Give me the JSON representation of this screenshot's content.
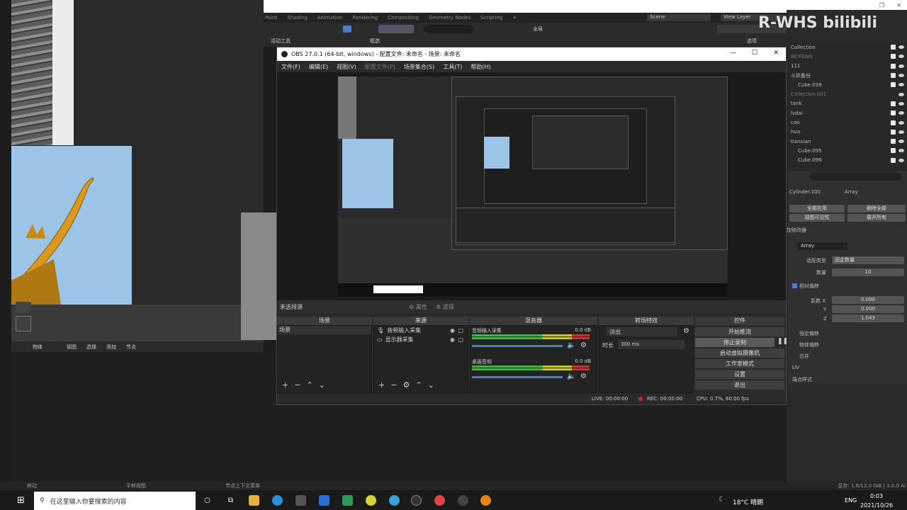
{
  "blender": {
    "tabs": [
      "Paint",
      "Shading",
      "Animation",
      "Rendering",
      "Compositing",
      "Geometry Nodes",
      "Scripting",
      "+"
    ],
    "scene_label": "Scene",
    "view_layer_label": "View Layer",
    "active_tool_label": "活动工具",
    "select_label": "框选",
    "global_label": "全局",
    "options_label": "选项",
    "outliner": [
      {
        "name": "Collection"
      },
      {
        "name": "BEIFENG"
      },
      {
        "name": "111"
      },
      {
        "name": "斗拱备份"
      },
      {
        "name": "Cube.038"
      },
      {
        "name": "Collection.001"
      },
      {
        "name": "tank"
      },
      {
        "name": "lvdai"
      },
      {
        "name": "cao"
      },
      {
        "name": "hua"
      },
      {
        "name": "tianxian"
      },
      {
        "name": "Cube.095"
      },
      {
        "name": "Cube.096"
      }
    ],
    "props": {
      "object_name": "Cylinder.100",
      "modifier_type_label": "Array",
      "apply_all": "全部应用",
      "delete_all": "删除全部",
      "viewport_vis": "视图可见性",
      "expand_all": "展开所有",
      "modifier_header": "加修改器",
      "modifier_name": "Array",
      "fit_type_label": "适配类型",
      "fit_type_value": "固定数量",
      "count_label": "数量",
      "count_value": "10",
      "relative_offset": "相对偏移",
      "factor_x_label": "系数 X",
      "factor_x": "0.000",
      "y_label": "Y",
      "factor_y": "0.000",
      "z_label": "Z",
      "factor_z": "1.043",
      "constant_offset": "恒定偏移",
      "object_offset": "物体偏移",
      "merge": "合并",
      "uv": "UV",
      "caps": "端点样式"
    },
    "node_bar": [
      "物体",
      "视图",
      "选择",
      "添加",
      "节点"
    ],
    "status": {
      "move": "移动",
      "pan": "平移视图",
      "context": "节点上下文菜单",
      "memory": "显存: 1.6/12.0 GiB | 3.0.0 Al"
    }
  },
  "obs": {
    "title": "OBS 27.0.1 (64-bit, windows) - 配置文件: 未命名 - 场景: 未命名",
    "menu": [
      "文件(F)",
      "编辑(E)",
      "视图(V)",
      "配置文件(P)",
      "场景集合(S)",
      "工具(T)",
      "帮助(H)"
    ],
    "no_source": "未选择源",
    "properties_btn": "属性",
    "filters_btn": "滤镜",
    "docks": {
      "scenes": "场景",
      "sources": "来源",
      "mixer": "混音器",
      "transitions": "转场特效",
      "controls": "控件"
    },
    "scene_item": "场景",
    "sources": [
      {
        "name": "音频输入采集"
      },
      {
        "name": "显示器采集"
      }
    ],
    "mixer": [
      {
        "name": "音频输入采集",
        "db": "0.0 dB"
      },
      {
        "name": "桌面音频",
        "db": "0.0 dB"
      }
    ],
    "transition_value": "淡出",
    "duration_label": "时长",
    "duration_value": "300 ms",
    "controls": [
      "开始推流",
      "停止录制",
      "启动虚拟摄像机",
      "工作室模式",
      "设置",
      "退出"
    ],
    "status": {
      "live": "LIVE: 00:00:00",
      "rec": "REC: 00:00:00",
      "cpu": "CPU: 0.7%, 60.00 fps"
    }
  },
  "taskbar": {
    "search_placeholder": "在这里输入你要搜索的内容",
    "weather": "18°C 晴朗",
    "lang": "ENG",
    "time": "0:03",
    "date": "2021/10/26"
  },
  "watermark": "R-WHS bilibili",
  "colors": {
    "accent": "#4a7fc7",
    "rec_red": "#d02020",
    "sky": "#9cc4e6",
    "ornament": "#e0a020"
  }
}
